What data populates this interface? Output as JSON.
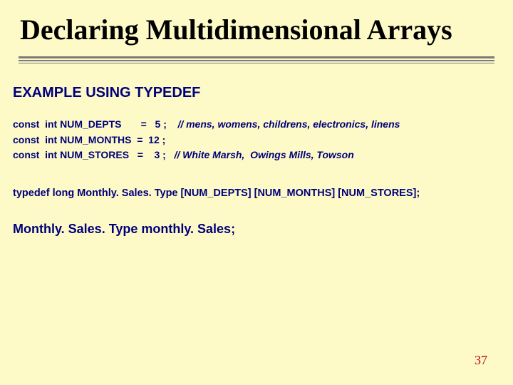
{
  "title": "Declaring Multidimensional Arrays",
  "subhead": "EXAMPLE USING TYPEDEF",
  "code": {
    "line1": "const  int NUM_DEPTS       =   5 ;    ",
    "comment1": "// mens, womens, childrens, electronics, linens",
    "line2": "const  int NUM_MONTHS  =  12 ;",
    "line3": "const  int NUM_STORES   =    3 ;   ",
    "comment3": "// White Marsh,  Owings Mills, Towson"
  },
  "typedef": "typedef  long Monthly. Sales. Type [NUM_DEPTS] [NUM_MONTHS] [NUM_STORES];",
  "decl": "Monthly. Sales. Type   monthly. Sales;",
  "pagenum": "37"
}
